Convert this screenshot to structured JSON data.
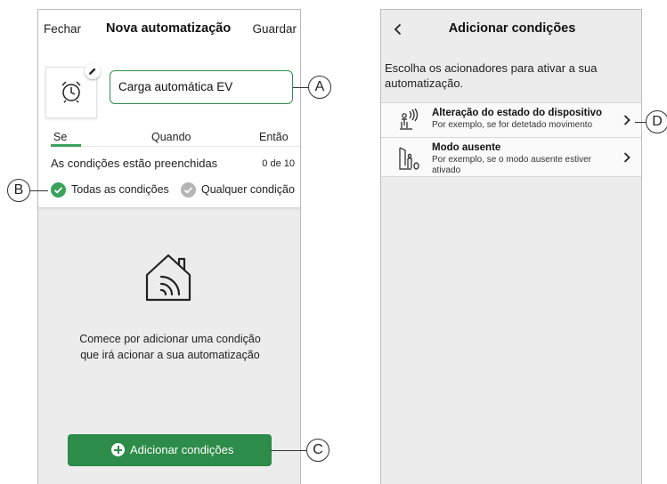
{
  "left": {
    "nav": {
      "close": "Fechar",
      "title": "Nova automatização",
      "save": "Guardar"
    },
    "name_value": "Carga automática EV",
    "tabs": [
      "Se",
      "Quando",
      "Então"
    ],
    "conditions_status": "As condições estão preenchidas",
    "conditions_count": "0 de 10",
    "radio_all": "Todas as condições",
    "radio_any": "Qualquer condição",
    "empty_line1": "Comece por adicionar uma condição",
    "empty_line2": "que irá acionar a sua automatização",
    "add_button": "Adicionar condições",
    "colors": {
      "accent": "#2d8c49",
      "radio_off": "#b5b5b5"
    },
    "icons": [
      "alarm-clock-icon",
      "pencil-icon",
      "check-icon",
      "smart-home-icon",
      "plus-icon"
    ]
  },
  "right": {
    "title": "Adicionar condições",
    "description": "Escolha os acionadores para ativar a sua automatização.",
    "options": [
      {
        "title": "Alteração do estado do dispositivo",
        "subtitle": "Por exemplo, se for detetado movimento",
        "icon": "motion-sensor-icon"
      },
      {
        "title": "Modo ausente",
        "subtitle": "Por exemplo, se o modo ausente estiver ativado",
        "icon": "away-mode-icon"
      }
    ]
  },
  "callouts": [
    "A",
    "B",
    "C",
    "D"
  ]
}
